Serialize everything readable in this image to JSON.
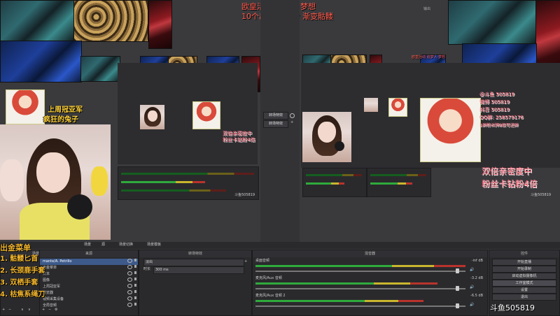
{
  "overlay": {
    "top_red_line1": "欧皇活动  追梦人    梦想",
    "top_red_line2": "10个出金  啊哈哈  渐变骷髅",
    "left_yellow_line1": "上周冠亚军",
    "left_yellow_line2": "疯狂的兔子",
    "menu_title": "出金菜单",
    "menu_items": [
      "1. 骷髅匕首",
      "2. 长颈鹿手套",
      "3. 双栖手套",
      "4. 枯焦系绳刀"
    ],
    "menu_behind_text": "mante/A. Petrillo",
    "right_pink_lines": [
      "双倍亲密度中",
      "粉丝卡钻粉4倍"
    ],
    "left_pink_lines": [
      "双倍亲密度中",
      "粉丝卡钻粉4倍"
    ],
    "watermark_bottom": "斗鱼505819",
    "watermark_left_preview": "斗鱼505819",
    "watermark_right_preview": "斗鱼505819",
    "top_gray_label": "输出",
    "social_lines": [
      "@斗鱼 505819",
      "微博 505819",
      "抖音 505819",
      "QQ群: 258579176",
      "1群粉丝牌8级可进群"
    ]
  },
  "transition": {
    "label": "转场特效",
    "duration_label": "时长",
    "duration_value": "300 ms"
  },
  "bottom_panels": {
    "scenes_title": "场景",
    "sources_title": "来源",
    "mixer_title": "混音器",
    "transition_title": "转场特效",
    "controls_title": "控件",
    "tabs": [
      "场景",
      "源",
      "场景切换",
      "场景模板"
    ],
    "scenes": [
      "出金菜单",
      "欧皇活动",
      "摄像头",
      "桌面",
      "游戏画面",
      "窗口",
      "开场",
      "结束"
    ],
    "sources": [
      "mante/A. Petrillo",
      "出金菜单",
      "文本",
      "图像",
      "上周冠亚军",
      "浏览器",
      "视频采集设备",
      "全局音频"
    ],
    "mixer_channels": [
      {
        "name": "桌面音频",
        "db": "-inf dB"
      },
      {
        "name": "麦克风/Aux 音频",
        "db": "-3.2 dB"
      },
      {
        "name": "麦克风/Aux 音频 2",
        "db": "-6.5 dB"
      }
    ],
    "transition_select": "淡出",
    "controls": [
      "开始直播",
      "开始录制",
      "启动虚拟摄像机",
      "工作室模式",
      "设置",
      "退出"
    ]
  },
  "colors": {
    "bg": "#3a3a3d",
    "meter_green": "#2faa3c",
    "meter_yellow": "#c9b62e",
    "meter_red": "#b8332c",
    "overlay_red": "#ff5a4a",
    "overlay_yellow": "#ffd23a",
    "selected_row": "#3d5a8a"
  }
}
